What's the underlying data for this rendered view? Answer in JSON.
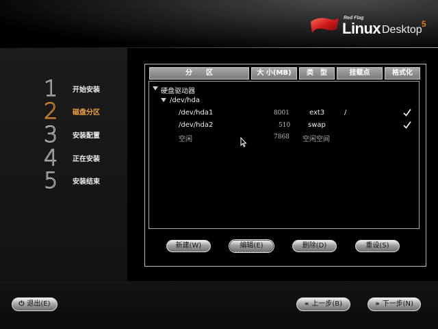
{
  "brand": {
    "small": "Red Flag",
    "name": "Linux",
    "product": "Desktop",
    "version": "5",
    "accent": "#cc2222"
  },
  "steps": [
    {
      "num": "1",
      "label": "开始安装",
      "active": false
    },
    {
      "num": "2",
      "label": "磁盘分区",
      "active": true
    },
    {
      "num": "3",
      "label": "安装配置",
      "active": false
    },
    {
      "num": "4",
      "label": "正在安装",
      "active": false
    },
    {
      "num": "5",
      "label": "安装结束",
      "active": false
    }
  ],
  "table": {
    "headers": [
      "分　　区",
      "大 小(MB)",
      "类　型",
      "挂载点",
      "格式化"
    ],
    "tree_root": "硬盘驱动器",
    "device": "/dev/hda",
    "rows": [
      {
        "partition": "/dev/hda1",
        "size": "8001",
        "type": "ext3",
        "mount": "/",
        "format": true
      },
      {
        "partition": "/dev/hda2",
        "size": "510",
        "type": "swap",
        "mount": "",
        "format": true
      },
      {
        "partition": "空闲",
        "size": "7868",
        "type": "空闲空间",
        "mount": "",
        "format": false
      }
    ]
  },
  "actions": {
    "new": "新建(W)",
    "edit": "编辑(E)",
    "delete": "删除(D)",
    "reset": "重设(S)"
  },
  "footer": {
    "exit": "退出(E)",
    "back": "上一步(B)",
    "next": "下一步(N)"
  },
  "colors": {
    "step_active": "#f0a040",
    "step_inactive": "#eeeeee"
  },
  "icons": {
    "exit": "power-icon",
    "back": "double-chevron-left-icon",
    "next": "double-chevron-right-icon",
    "format": "checkmark-icon",
    "expand": "triangle-down-icon"
  }
}
